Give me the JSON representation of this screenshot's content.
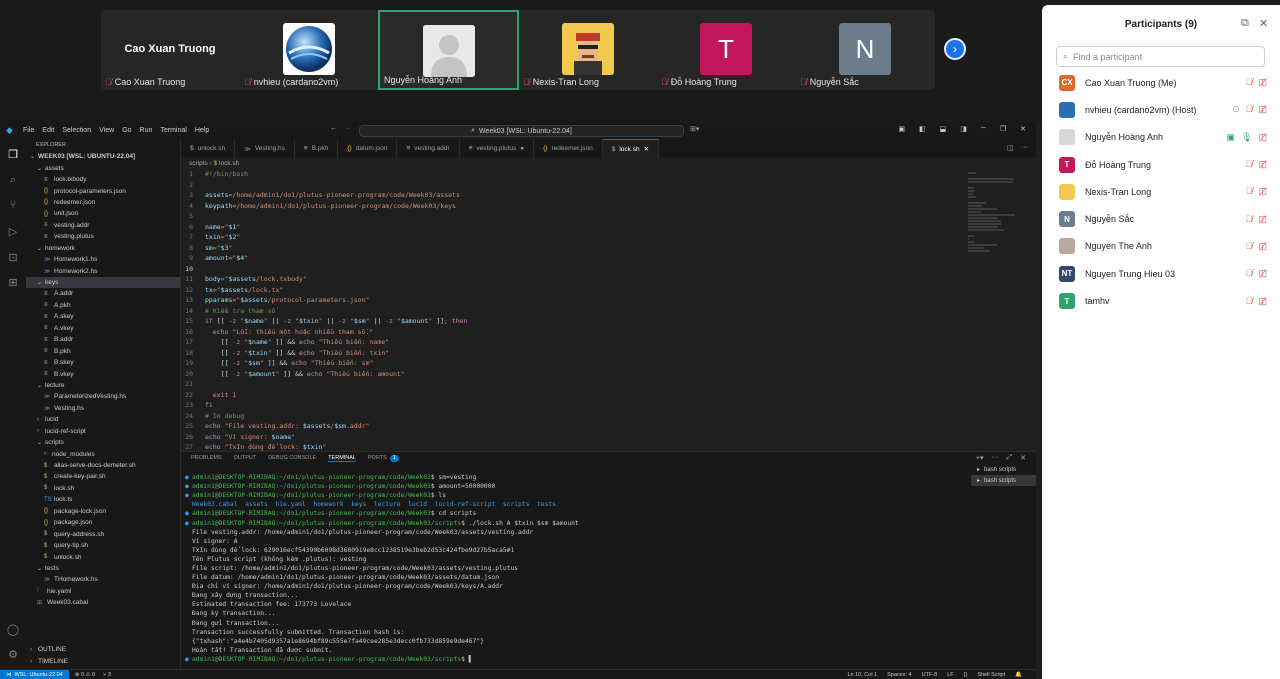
{
  "meeting": {
    "tiles": [
      {
        "name": "Cao Xuan Truong",
        "label": "Cao Xuan Truong",
        "type": "name"
      },
      {
        "name": "nvhieu (cardano2vm)",
        "label": "nvhieu (cardano2vm)",
        "type": "logo"
      },
      {
        "name": "Nguyễn Hoàng Anh",
        "label": "Nguyễn Hoàng Anh",
        "type": "silhouette",
        "active": true
      },
      {
        "name": "Nexis-Tran Long",
        "label": "Nexis-Tran Long",
        "type": "pixel"
      },
      {
        "name": "Đỗ Hoàng Trung",
        "label": "Đỗ Hoàng Trung",
        "type": "letter",
        "letter": "T",
        "color": "#c2185b"
      },
      {
        "name": "Nguyễn Sắc",
        "label": "Nguyễn Sắc",
        "type": "letter",
        "letter": "N",
        "color": "#6b7c8c"
      }
    ],
    "next_icon": "chevron-right-icon"
  },
  "participants": {
    "title": "Participants (9)",
    "search_placeholder": "Find a participant",
    "list": [
      {
        "avatar": "CX",
        "color": "#e0672c",
        "name": "Cao Xuan Truong (Me)",
        "muted": true,
        "video_off": true
      },
      {
        "avatar": "",
        "color": "#2a6fb8",
        "name": "nvhieu (cardano2vm) (Host)",
        "muted": true,
        "video_off": true,
        "extra": "circle-icon"
      },
      {
        "avatar": "",
        "color": "#d8d8d8",
        "name": "Nguyễn Hoàng Anh",
        "muted": false,
        "video_off": true,
        "extra": "share-icon"
      },
      {
        "avatar": "T",
        "color": "#c2185b",
        "name": "Đỗ Hoàng Trung",
        "muted": true,
        "video_off": true
      },
      {
        "avatar": "",
        "color": "#f2c94c",
        "name": "Nexis-Tran Long",
        "muted": true,
        "video_off": true
      },
      {
        "avatar": "N",
        "color": "#6b7c8c",
        "name": "Nguyễn Sắc",
        "muted": true,
        "video_off": true
      },
      {
        "avatar": "",
        "color": "#b9a7a0",
        "name": "Nguyen The Anh",
        "muted": true,
        "video_off": true
      },
      {
        "avatar": "NT",
        "color": "#2f4a6b",
        "name": "Nguyen Trung Hieu 03",
        "muted": true,
        "video_off": true
      },
      {
        "avatar": "T",
        "color": "#2fa36b",
        "name": "tamhv",
        "muted": true,
        "video_off": true
      }
    ]
  },
  "vscode": {
    "menu": [
      "File",
      "Edit",
      "Selection",
      "View",
      "Go",
      "Run",
      "Terminal",
      "Help"
    ],
    "command_center": "Week03 [WSL: Ubuntu-22.04]",
    "explorer_label": "EXPLORER",
    "tree": [
      {
        "depth": 0,
        "type": "folder",
        "open": true,
        "label": "WEEK03 [WSL: UBUNTU-22.04]"
      },
      {
        "depth": 1,
        "type": "folder",
        "open": true,
        "label": "assets"
      },
      {
        "depth": 2,
        "type": "file",
        "label": "lock.txbody"
      },
      {
        "depth": 2,
        "type": "json",
        "label": "protocol-parameters.json"
      },
      {
        "depth": 2,
        "type": "json",
        "label": "redeemer.json"
      },
      {
        "depth": 2,
        "type": "json",
        "label": "unit.json"
      },
      {
        "depth": 2,
        "type": "file",
        "label": "vesting.addr"
      },
      {
        "depth": 2,
        "type": "file",
        "label": "vesting.plutus"
      },
      {
        "depth": 1,
        "type": "folder",
        "open": true,
        "label": "homework"
      },
      {
        "depth": 2,
        "type": "hs",
        "label": "Homework1.hs"
      },
      {
        "depth": 2,
        "type": "hs",
        "label": "Homework2.hs"
      },
      {
        "depth": 1,
        "type": "folder",
        "open": true,
        "label": "keys",
        "selected": true
      },
      {
        "depth": 2,
        "type": "file",
        "label": "A.addr"
      },
      {
        "depth": 2,
        "type": "file",
        "label": "A.pkh"
      },
      {
        "depth": 2,
        "type": "file",
        "label": "A.skey"
      },
      {
        "depth": 2,
        "type": "file",
        "label": "A.vkey"
      },
      {
        "depth": 2,
        "type": "file",
        "label": "B.addr"
      },
      {
        "depth": 2,
        "type": "file",
        "label": "B.pkh"
      },
      {
        "depth": 2,
        "type": "file",
        "label": "B.skey"
      },
      {
        "depth": 2,
        "type": "file",
        "label": "B.vkey"
      },
      {
        "depth": 1,
        "type": "folder",
        "open": true,
        "label": "lecture"
      },
      {
        "depth": 2,
        "type": "hs",
        "label": "ParameterizedVesting.hs"
      },
      {
        "depth": 2,
        "type": "hs",
        "label": "Vesting.hs"
      },
      {
        "depth": 1,
        "type": "folder",
        "open": false,
        "label": "lucid"
      },
      {
        "depth": 1,
        "type": "folder",
        "open": false,
        "label": "lucid-ref-script"
      },
      {
        "depth": 1,
        "type": "folder",
        "open": true,
        "label": "scripts"
      },
      {
        "depth": 2,
        "type": "folder",
        "open": false,
        "label": "node_modules"
      },
      {
        "depth": 2,
        "type": "sh",
        "label": "alias-serve-docs-demeter.sh"
      },
      {
        "depth": 2,
        "type": "sh",
        "label": "create-key-pair.sh"
      },
      {
        "depth": 2,
        "type": "sh",
        "label": "lock.sh"
      },
      {
        "depth": 2,
        "type": "ts",
        "label": "lock.ts"
      },
      {
        "depth": 2,
        "type": "json",
        "label": "package-lock.json"
      },
      {
        "depth": 2,
        "type": "json",
        "label": "package.json"
      },
      {
        "depth": 2,
        "type": "sh",
        "label": "query-address.sh"
      },
      {
        "depth": 2,
        "type": "sh",
        "label": "query-tip.sh"
      },
      {
        "depth": 2,
        "type": "sh",
        "label": "unlock.sh"
      },
      {
        "depth": 1,
        "type": "folder",
        "open": true,
        "label": "tests"
      },
      {
        "depth": 2,
        "type": "hs",
        "label": "THomework.hs"
      },
      {
        "depth": 1,
        "type": "yaml",
        "label": "hie.yaml"
      },
      {
        "depth": 1,
        "type": "cabal",
        "label": "Week03.cabal"
      }
    ],
    "outline_label": "OUTLINE",
    "timeline_label": "TIMELINE",
    "tabs": [
      {
        "label": "unlock.sh",
        "icon": "$"
      },
      {
        "label": "Vesting.hs",
        "icon": "≫"
      },
      {
        "label": "B.pkh",
        "icon": "≡"
      },
      {
        "label": "datum.json",
        "icon": "{}"
      },
      {
        "label": "vesting.addr",
        "icon": "≡"
      },
      {
        "label": "vesting.plutus",
        "icon": "≡",
        "dirty": true
      },
      {
        "label": "redeemer.json",
        "icon": "{}"
      },
      {
        "label": "lock.sh",
        "icon": "$",
        "active": true
      }
    ],
    "breadcrumb": [
      "scripts",
      "lock.sh"
    ],
    "code": [
      {
        "n": "1",
        "t": "#!/bin/bash"
      },
      {
        "n": "2",
        "t": ""
      },
      {
        "n": "3",
        "t": "assets=/home/admin1/do1/plutus-pioneer-program/code/Week03/assets"
      },
      {
        "n": "4",
        "t": "keypath=/home/admin1/do1/plutus-pioneer-program/code/Week03/keys"
      },
      {
        "n": "5",
        "t": ""
      },
      {
        "n": "6",
        "t": "name=\"$1\""
      },
      {
        "n": "7",
        "t": "txin=\"$2\""
      },
      {
        "n": "8",
        "t": "sm=\"$3\""
      },
      {
        "n": "9",
        "t": "amount=\"$4\""
      },
      {
        "n": "10",
        "t": ""
      },
      {
        "n": "11",
        "t": "body=\"$assets/lock.txbody\""
      },
      {
        "n": "12",
        "t": "tx=\"$assets/lock.tx\""
      },
      {
        "n": "13",
        "t": "pparams=\"$assets/protocol-parameters.json\""
      },
      {
        "n": "14",
        "t": "# Kiểm tra tham số"
      },
      {
        "n": "15",
        "t": "if [[ -z \"$name\" || -z \"$txin\" || -z \"$sm\" || -z \"$amount\" ]]; then"
      },
      {
        "n": "16",
        "t": "  echo \"Lỗi: thiếu một hoặc nhiều tham số.\""
      },
      {
        "n": "17",
        "t": "    [[ -z \"$name\" ]] && echo \"Thiếu biến: name\""
      },
      {
        "n": "18",
        "t": "    [[ -z \"$txin\" ]] && echo \"Thiếu biến: txin\""
      },
      {
        "n": "19",
        "t": "    [[ -z \"$sm\" ]] && echo \"Thiếu biến: sm\""
      },
      {
        "n": "20",
        "t": "    [[ -z \"$amount\" ]] && echo \"Thiếu biến: amount\""
      },
      {
        "n": "21",
        "t": ""
      },
      {
        "n": "22",
        "t": "  exit 1"
      },
      {
        "n": "23",
        "t": "fi"
      },
      {
        "n": "24",
        "t": "# In debug"
      },
      {
        "n": "25",
        "t": "echo \"File vesting.addr: $assets/$sm.addr\""
      },
      {
        "n": "26",
        "t": "echo \"Ví signer: $name\""
      },
      {
        "n": "27",
        "t": "echo \"TxIn dùng để lock: $txin\""
      }
    ],
    "current_line": "10",
    "panel_tabs": [
      "PROBLEMS",
      "OUTPUT",
      "DEBUG CONSOLE",
      "TERMINAL",
      "PORTS"
    ],
    "ports_count": "1",
    "terminal": [
      {
        "dot": true,
        "prompt": "admin1@DESKTOP-RIMIBAQ:~/do1/plutus-pioneer-program/code/Week03",
        "cmd": "$ sm=vesting"
      },
      {
        "dot": true,
        "prompt": "admin1@DESKTOP-RIMIBAQ:~/do1/plutus-pioneer-program/code/Week03",
        "cmd": "$ amount=50000000"
      },
      {
        "dot": true,
        "prompt": "admin1@DESKTOP-RIMIBAQ:~/do1/plutus-pioneer-program/code/Week03",
        "cmd": "$ ls"
      },
      {
        "dot": false,
        "text": "Week03.cabal  assets  hie.yaml  homework  keys  lecture  lucid  lucid-ref-script  scripts  tests"
      },
      {
        "dot": true,
        "prompt": "admin1@DESKTOP-RIMIBAQ:~/do1/plutus-pioneer-program/code/Week03",
        "cmd": "$ cd scripts"
      },
      {
        "dot": true,
        "prompt": "admin1@DESKTOP-RIMIBAQ:~/do1/plutus-pioneer-program/code/Week03/scripts",
        "cmd": "$ ./lock.sh A $txin $sm $amount"
      },
      {
        "dot": false,
        "text": "File vesting.addr: /home/admin1/do1/plutus-pioneer-program/code/Week03/assets/vesting.addr"
      },
      {
        "dot": false,
        "text": "Ví signer: A"
      },
      {
        "dot": false,
        "text": "TxIn dùng để lock: 629016ecf54390b6098d3680919e8cc1238519e3beb2d53c424fbe9d27b5aca5#1"
      },
      {
        "dot": false,
        "text": "Tên Plutus script (không kèm .plutus): vesting"
      },
      {
        "dot": false,
        "text": "File script: /home/admin1/do1/plutus-pioneer-program/code/Week03/assets/vesting.plutus"
      },
      {
        "dot": false,
        "text": "File datum: /home/admin1/do1/plutus-pioneer-program/code/Week03/assets/datum.json"
      },
      {
        "dot": false,
        "text": "Địa chỉ ví signer: /home/admin1/do1/plutus-pioneer-program/code/Week03/keys/A.addr"
      },
      {
        "dot": false,
        "text": "Đang xây dựng transaction..."
      },
      {
        "dot": false,
        "text": "Estimated transaction fee: 173773 Lovelace"
      },
      {
        "dot": false,
        "text": "Đang ký transaction..."
      },
      {
        "dot": false,
        "text": "Đang gửi transaction..."
      },
      {
        "dot": false,
        "text": "Transaction successfully submitted. Transaction hash is:"
      },
      {
        "dot": false,
        "text": "{\"txhash\":\"a4e4b7405d9357a1e8694bf89c555e7fa49cee285e3decc0fb733d859e9de467\"}"
      },
      {
        "dot": false,
        "text": "Hoàn tất! Transaction đã được submit."
      },
      {
        "dot": true,
        "prompt": "admin1@DESKTOP-RIMIBAQ:~/do1/plutus-pioneer-program/code/Week03/scripts",
        "cmd": "$ ▌"
      }
    ],
    "terminal_list": [
      "bash scripts",
      "bash scripts"
    ],
    "status": {
      "remote": "WSL: Ubuntu-22.04",
      "problems": "⊗ 0 ⚠ 0",
      "ports": "⑂ 3",
      "position": "Ln 10, Col 1",
      "spaces": "Spaces: 4",
      "encoding": "UTF-8",
      "eol": "LF",
      "language": "Shell Script"
    }
  }
}
